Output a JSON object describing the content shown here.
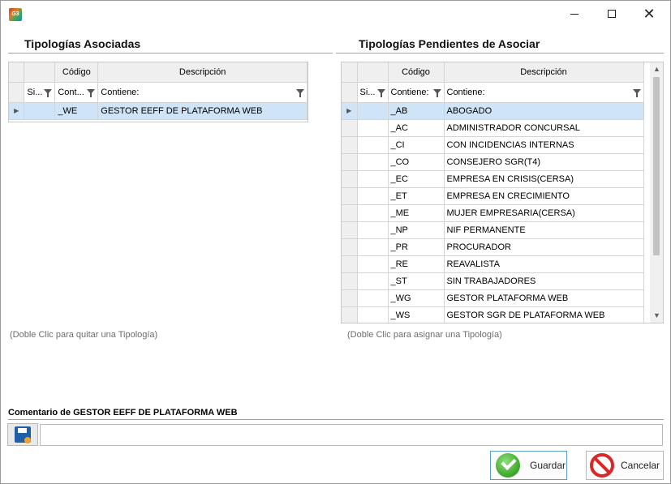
{
  "window": {
    "app_icon_text": "G3",
    "minimize_icon": "minimize-icon",
    "maximize_icon": "maximize-icon",
    "close_glyph": "✕"
  },
  "left": {
    "title": "Tipologías Asociadas",
    "columns": {
      "codigo": "Código",
      "descripcion": "Descripción"
    },
    "filters": {
      "si": "Si...",
      "contiene_short": "Cont...",
      "contiene": "Contiene:"
    },
    "rows": [
      {
        "codigo": "_WE",
        "descripcion": "GESTOR EEFF DE PLATAFORMA WEB",
        "selected": true
      }
    ],
    "hint": "(Doble Clic para quitar una Tipología)"
  },
  "right": {
    "title": "Tipologías Pendientes de Asociar",
    "columns": {
      "codigo": "Código",
      "descripcion": "Descripción"
    },
    "filters": {
      "si": "Si...",
      "contiene_codigo": "Contiene:",
      "contiene": "Contiene:"
    },
    "rows": [
      {
        "codigo": "_AB",
        "descripcion": "ABOGADO",
        "selected": true
      },
      {
        "codigo": "_AC",
        "descripcion": "ADMINISTRADOR CONCURSAL"
      },
      {
        "codigo": "_CI",
        "descripcion": "CON INCIDENCIAS INTERNAS"
      },
      {
        "codigo": "_CO",
        "descripcion": "CONSEJERO SGR(T4)"
      },
      {
        "codigo": "_EC",
        "descripcion": "EMPRESA EN CRISIS(CERSA)"
      },
      {
        "codigo": "_ET",
        "descripcion": "EMPRESA EN CRECIMIENTO"
      },
      {
        "codigo": "_ME",
        "descripcion": "MUJER EMPRESARIA(CERSA)"
      },
      {
        "codigo": "_NP",
        "descripcion": "NIF PERMANENTE"
      },
      {
        "codigo": "_PR",
        "descripcion": "PROCURADOR"
      },
      {
        "codigo": "_RE",
        "descripcion": "REAVALISTA"
      },
      {
        "codigo": "_ST",
        "descripcion": "SIN TRABAJADORES"
      },
      {
        "codigo": "_WG",
        "descripcion": "GESTOR PLATAFORMA WEB"
      },
      {
        "codigo": "_WS",
        "descripcion": "GESTOR SGR DE PLATAFORMA WEB"
      }
    ],
    "hint": "(Doble Clic para asignar una Tipología)"
  },
  "comment": {
    "label": "Comentario de GESTOR EEFF DE PLATAFORMA WEB",
    "value": "",
    "save_icon": "floppy-disk-icon"
  },
  "buttons": {
    "save_label": "Guardar",
    "cancel_label": "Cancelar",
    "save_icon": "check-circle-icon",
    "cancel_icon": "no-entry-icon"
  },
  "colors": {
    "accent_line": "#6fb3c8",
    "selected_row": "#cfe4f7",
    "header_bg": "#efefef"
  }
}
